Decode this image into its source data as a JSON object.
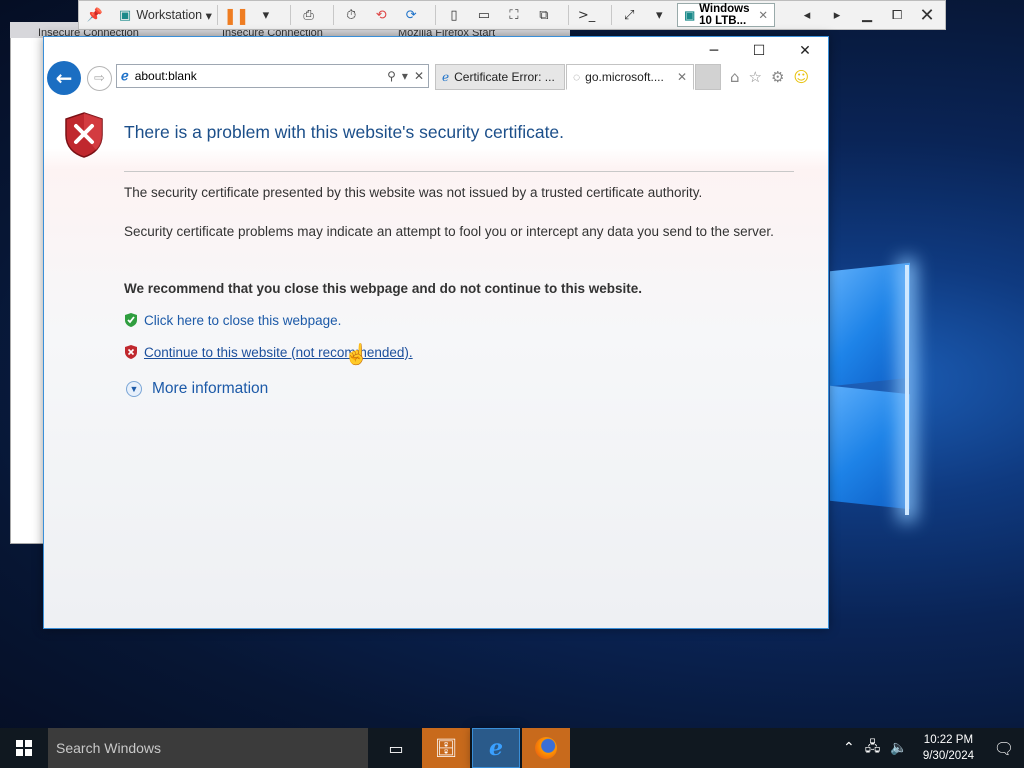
{
  "vm_toolbar": {
    "workstation_label": "Workstation",
    "vm_tab_label": "Windows 10 LTB...",
    "vm_tab_close": "✕"
  },
  "firefox_bg": {
    "tabs": [
      "Insecure Connection",
      "Insecure Connection",
      "Mozilla Firefox Start"
    ]
  },
  "ie": {
    "address": "about:blank",
    "tabs": [
      {
        "label": "Certificate Error: ...",
        "state": "inactive"
      },
      {
        "label": "go.microsoft....",
        "state": "active"
      }
    ],
    "window_controls": {
      "minimize": "─",
      "maximize": "☐",
      "close": "✕"
    }
  },
  "page": {
    "heading": "There is a problem with this website's security certificate.",
    "p1": "The security certificate presented by this website was not issued by a trusted certificate authority.",
    "p2": "Security certificate problems may indicate an attempt to fool you or intercept any data you send to the server.",
    "recommend": "We recommend that you close this webpage and do not continue to this website.",
    "close_link": "Click here to close this webpage.",
    "continue_link": "Continue to this website (not recommended).",
    "more_info": "More information"
  },
  "taskbar": {
    "search_placeholder": "Search Windows",
    "time": "10:22 PM",
    "date": "9/30/2024"
  },
  "colors": {
    "heading": "#1c4f8a",
    "link": "#1c5aa8",
    "taskbar": "#101820",
    "accent_orange": "#c86a1c"
  }
}
